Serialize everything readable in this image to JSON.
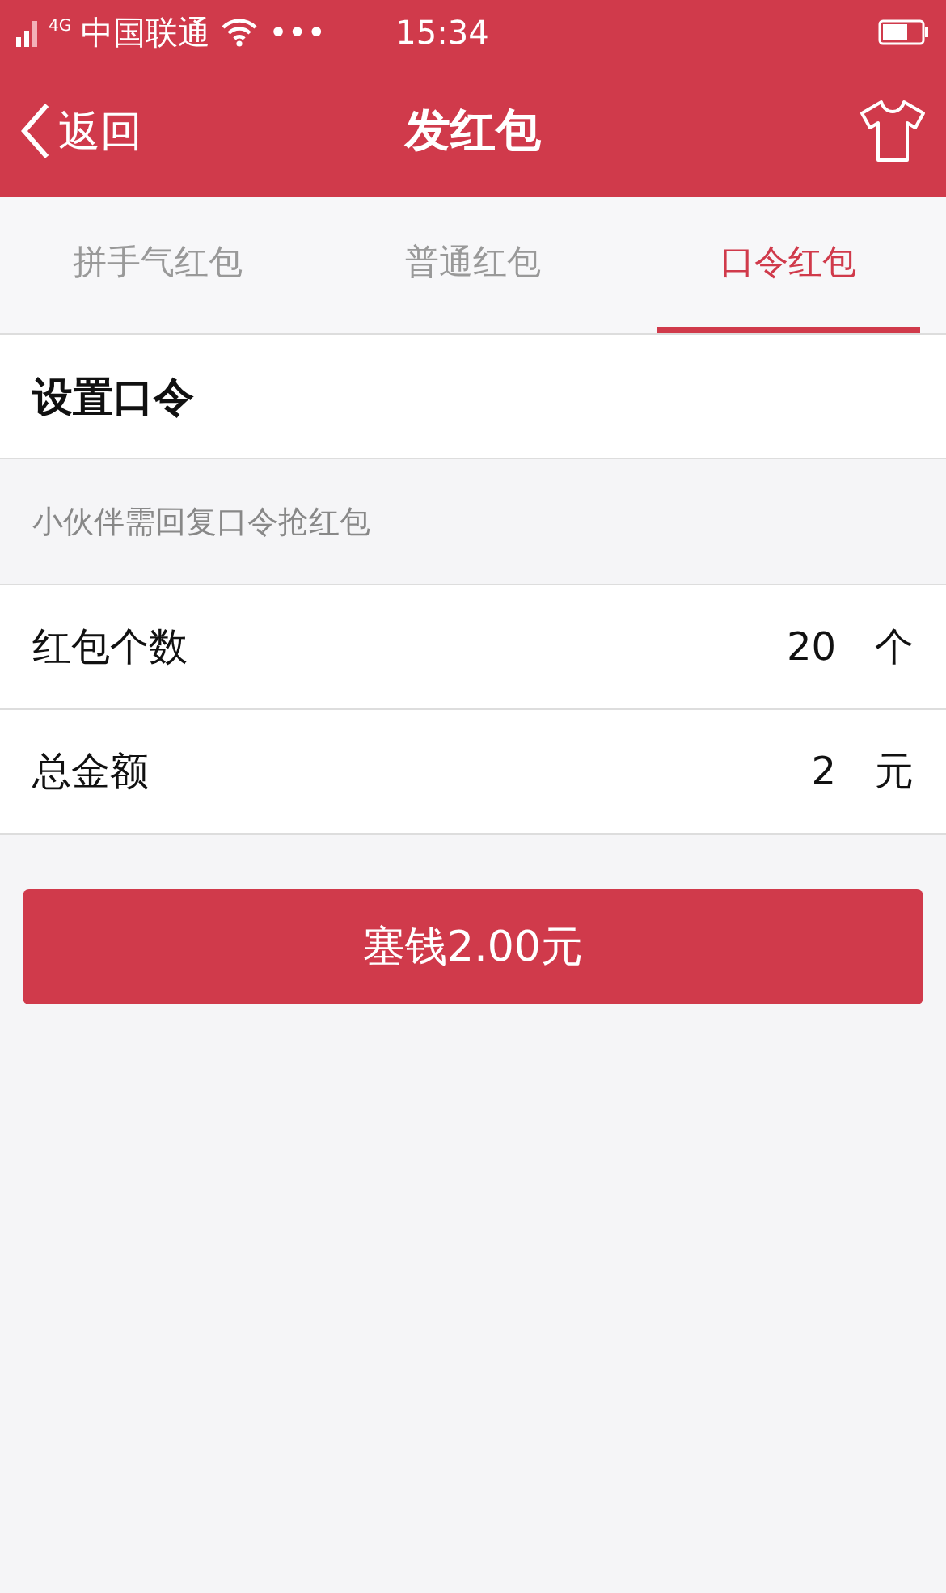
{
  "status_bar": {
    "network": "4G",
    "carrier": "中国联通",
    "more": "•••",
    "time": "15:34"
  },
  "nav": {
    "back": "返回",
    "title": "发红包"
  },
  "tabs": [
    {
      "label": "拼手气红包",
      "selected": false
    },
    {
      "label": "普通红包",
      "selected": false
    },
    {
      "label": "口令红包",
      "selected": true
    }
  ],
  "password_field": {
    "placeholder": "设置口令"
  },
  "hint": "小伙伴需回复口令抢红包",
  "rows": [
    {
      "label": "红包个数",
      "value": "20",
      "unit": "个"
    },
    {
      "label": "总金额",
      "value": "2",
      "unit": "元"
    }
  ],
  "submit": "塞钱2.00元"
}
